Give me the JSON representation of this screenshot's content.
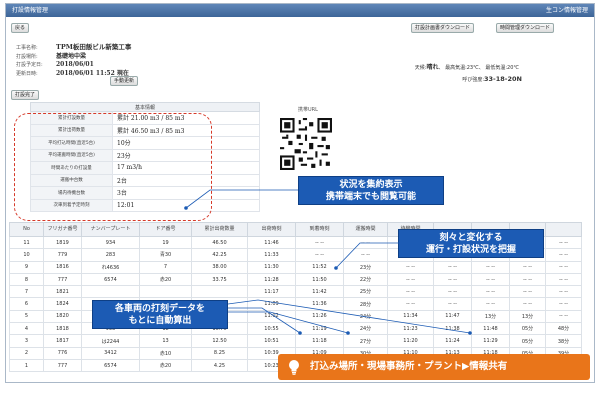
{
  "window": {
    "title": "打設情報管理",
    "right_label": "生コン情報管理"
  },
  "buttons": {
    "back": "戻る",
    "plan_download": "打設計画書ダウンロード",
    "report_download": "時間管理ダウンロード",
    "manual_update": "手動更新",
    "finish": "打設完了"
  },
  "info": {
    "site_label": "工事名称:",
    "site_value": "TPM板田飯ビル新築工事",
    "place_label": "打設場所:",
    "place_value": "基礎地中梁",
    "date_label": "打設予定日:",
    "date_value": "2018/06/01",
    "updated_label": "更新日時:",
    "updated_value": "2018/06/01 11:52 現在"
  },
  "weather": {
    "label": "天候:",
    "value": "晴れ",
    "high_label": "最高気温:",
    "high_value": "23℃",
    "low_label": "最低気温:",
    "low_value": "20℃",
    "slump_label": "呼び強度:",
    "slump_value": "33-18-20N"
  },
  "summary": {
    "header": "基本情報",
    "rows": [
      {
        "k": "累計打設数量",
        "v": "累計 21.00 m3 / 85 m3"
      },
      {
        "k": "累計出荷数量",
        "v": "累計 46.50 m3 / 85 m3"
      },
      {
        "k": "平均打込時間(直近5台)",
        "v": "10分"
      },
      {
        "k": "平均運搬時間(直近5台)",
        "v": "23分"
      },
      {
        "k": "時間あたりの打設量",
        "v": "17 m3/h"
      },
      {
        "k": "運搬中台数",
        "v": "2台"
      },
      {
        "k": "場内待機台数",
        "v": "3台"
      },
      {
        "k": "次車到着予定時刻",
        "v": "12:01"
      }
    ]
  },
  "qr": {
    "label": "携帯URL"
  },
  "callouts": {
    "c1_line1": "状況を集約表示",
    "c1_line2": "携帯端末でも閲覧可能",
    "c2_line1": "刻々と変化する",
    "c2_line2": "運行・打設状況を把握",
    "c3_line1": "各車両の打刻データを",
    "c3_line2": "もとに自動算出"
  },
  "table": {
    "headers": [
      "No",
      "フリガナ番号",
      "ナンバープレート",
      "ドア番号",
      "累計出荷数量",
      "出荷時刻",
      "到着時刻",
      "運搬時間",
      "待機時間",
      "",
      "",
      "",
      ""
    ],
    "rows": [
      [
        "11",
        "1819",
        "934",
        "19",
        "46.50",
        "11:46",
        "-- --",
        "-- --",
        "-- --",
        "-- --",
        "-- --",
        "-- --",
        "-- --"
      ],
      [
        "10",
        "779",
        "283",
        "青30",
        "42.25",
        "11:33",
        "-- --",
        "-- --",
        "-- --",
        "-- --",
        "-- --",
        "-- --",
        "-- --"
      ],
      [
        "9",
        "1816",
        "れ4636",
        "7",
        "38.00",
        "11:30",
        "11:52",
        "23分",
        "-- --",
        "-- --",
        "-- --",
        "-- --",
        "-- --"
      ],
      [
        "8",
        "777",
        "6574",
        "赤20",
        "33.75",
        "11:28",
        "11:50",
        "22分",
        "-- --",
        "-- --",
        "-- --",
        "-- --",
        "-- --"
      ],
      [
        "7",
        "1821",
        "",
        "",
        "",
        "11:17",
        "11:42",
        "25分",
        "-- --",
        "-- --",
        "-- --",
        "-- --",
        "-- --"
      ],
      [
        "6",
        "1824",
        "",
        "",
        "",
        "11:09",
        "11:36",
        "28分",
        "-- --",
        "-- --",
        "-- --",
        "-- --",
        "-- --"
      ],
      [
        "5",
        "1820",
        "",
        "",
        "",
        "11:02",
        "11:26",
        "24分",
        "11:34",
        "11:47",
        "13分",
        "13分",
        "-- --"
      ],
      [
        "4",
        "1818",
        "938",
        "18",
        "16.75",
        "10:55",
        "11:19",
        "24分",
        "11:23",
        "11:38",
        "11:48",
        "05分",
        "48分"
      ],
      [
        "3",
        "1817",
        "は2244",
        "13",
        "12.50",
        "10:51",
        "11:18",
        "27分",
        "11:20",
        "11:24",
        "11:29",
        "05分",
        "38分"
      ],
      [
        "2",
        "776",
        "3412",
        "赤10",
        "8.25",
        "10:39",
        "11:09",
        "30分",
        "11:10",
        "11:13",
        "11:18",
        "05分",
        "39分"
      ],
      [
        "1",
        "777",
        "6574",
        "赤20",
        "4.25",
        "10:23",
        "10:50",
        "27分",
        "10:56",
        "11:06",
        "11:11",
        "05分",
        "48分"
      ]
    ]
  },
  "banner": {
    "text": "打込み場所・現場事務所・プラント▶情報共有"
  },
  "icons": {
    "bulb": "lightbulb-icon",
    "qr": "qr-code-icon"
  },
  "colors": {
    "accent_blue": "#1c5bb4",
    "banner_orange": "#e9751a",
    "dash_red": "#d63a2a"
  }
}
